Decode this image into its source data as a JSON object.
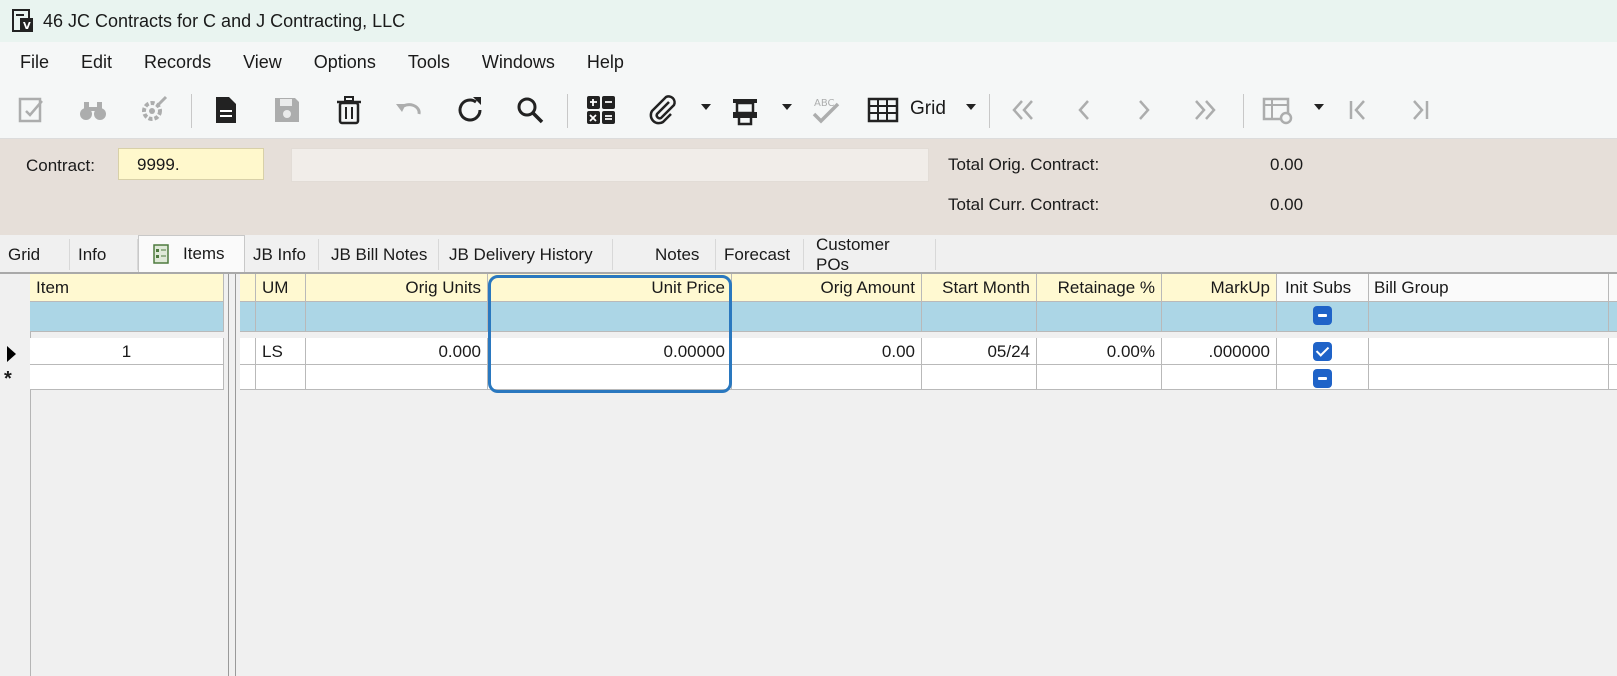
{
  "window": {
    "title": "46 JC Contracts for C and J Contracting, LLC"
  },
  "menu": [
    "File",
    "Edit",
    "Records",
    "View",
    "Options",
    "Tools",
    "Windows",
    "Help"
  ],
  "toolbar": {
    "grid_label": "Grid"
  },
  "header": {
    "contract_label": "Contract:",
    "contract_value": "9999.",
    "description_value": "",
    "total_orig_label": "Total Orig. Contract:",
    "total_orig_value": "0.00",
    "total_curr_label": "Total Curr. Contract:",
    "total_curr_value": "0.00"
  },
  "tabs": [
    "Grid",
    "Info",
    "Items",
    "JB Info",
    "JB Bill Notes",
    "JB Delivery History",
    "Notes",
    "Forecast",
    "Customer POs"
  ],
  "active_tab": "Items",
  "grid": {
    "columns": [
      "Item",
      "UM",
      "Orig Units",
      "Unit Price",
      "Orig Amount",
      "Start Month",
      "Retainage %",
      "MarkUp",
      "Init Subs",
      "Bill Group"
    ],
    "rows": [
      {
        "item": "1",
        "um": "LS",
        "orig_units": "0.000",
        "unit_price": "0.00000",
        "orig_amount": "0.00",
        "start_month": "05/24",
        "retainage": "0.00%",
        "markup": ".000000",
        "init_subs": "checked",
        "bill_group": ""
      }
    ],
    "new_row_symbol": "*"
  },
  "colors": {
    "accent": "#1f63c8",
    "header_yellow": "#fff9d1",
    "filter_blue": "#acd6e6",
    "highlight": "#2a78bf"
  }
}
